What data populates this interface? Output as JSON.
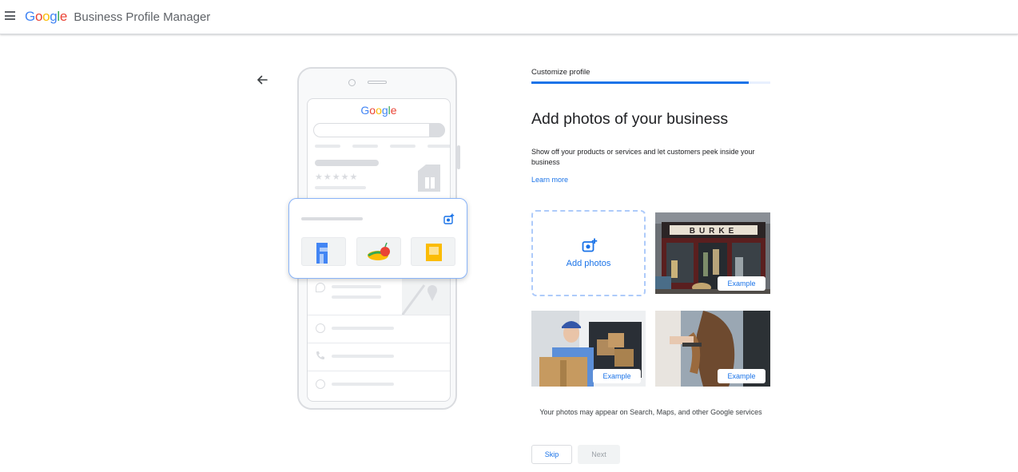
{
  "header": {
    "logo_letters": [
      {
        "char": "G",
        "color": "#4285F4"
      },
      {
        "char": "o",
        "color": "#EA4335"
      },
      {
        "char": "o",
        "color": "#FBBC05"
      },
      {
        "char": "g",
        "color": "#4285F4"
      },
      {
        "char": "l",
        "color": "#34A853"
      },
      {
        "char": "e",
        "color": "#EA4335"
      }
    ],
    "product_name": "Business Profile Manager",
    "menu_icon": "hamburger-menu-icon"
  },
  "illustration": {
    "search_brand": "Google",
    "stars": "★★★★★"
  },
  "step": {
    "label": "Customize profile",
    "progress_percent": 91
  },
  "main": {
    "heading": "Add photos of your business",
    "description": "Show off your products or services and let customers peek inside your business",
    "learn_more": "Learn more",
    "add_photos_label": "Add photos",
    "example_label": "Example",
    "disclaimer": "Your photos may appear on Search, Maps, and other Google services"
  },
  "actions": {
    "skip": "Skip",
    "next": "Next"
  },
  "colors": {
    "accent": "#1a73e8",
    "border": "#dadce0"
  }
}
